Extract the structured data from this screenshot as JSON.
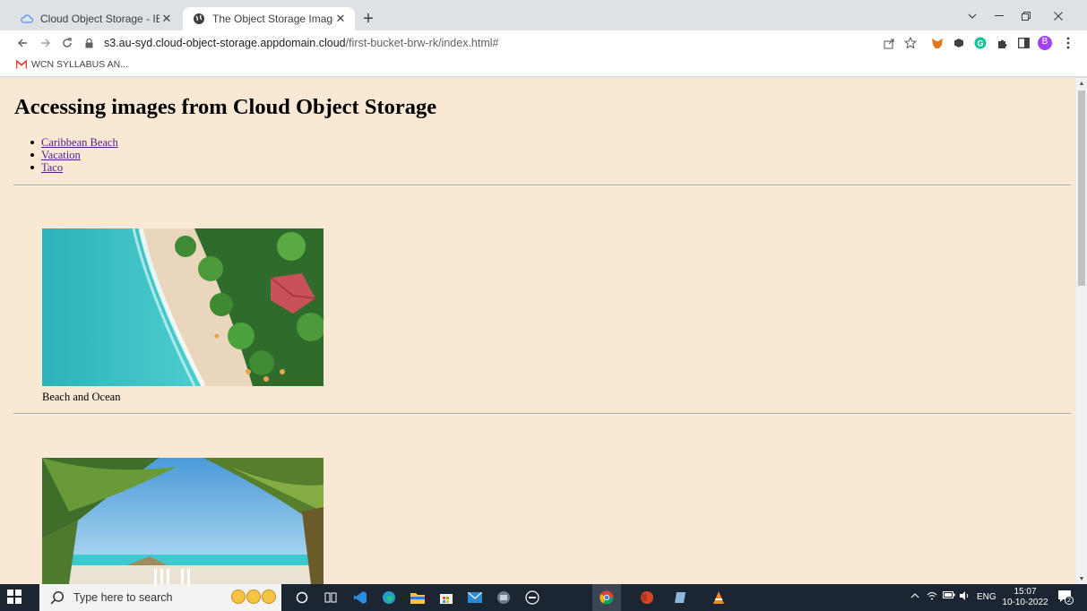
{
  "browser": {
    "tabs": [
      {
        "title": "Cloud Object Storage - IBM Clou",
        "active": false
      },
      {
        "title": "The Object Storage Image Viewe",
        "active": true
      }
    ],
    "new_tab_label": "+",
    "address": {
      "host": "s3.au-syd.cloud-object-storage.appdomain.cloud",
      "path": "/first-bucket-brw-rk/index.html#"
    },
    "bookmarks": [
      {
        "label": "WCN SYLLABUS AN..."
      }
    ],
    "profile_initial": "B"
  },
  "page": {
    "title": "Accessing images from Cloud Object Storage",
    "links": [
      {
        "label": "Caribbean Beach"
      },
      {
        "label": "Vacation"
      },
      {
        "label": "Taco"
      }
    ],
    "images": [
      {
        "caption": "Beach and Ocean"
      }
    ]
  },
  "taskbar": {
    "search_placeholder": "Type here to search",
    "language": "ENG",
    "time": "15:07",
    "date": "10-10-2022",
    "notification_count": "2"
  },
  "colors": {
    "page_background": "#f8e8d4",
    "link_visited": "#551a8b",
    "taskbar": "#1c2633"
  }
}
